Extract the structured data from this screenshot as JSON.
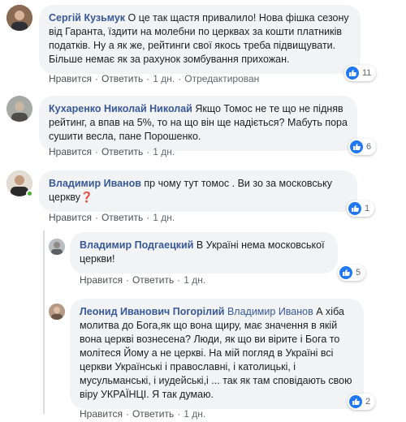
{
  "colors": {
    "author": "#385898",
    "bubble_bg": "#f2f3f5",
    "like_blue": "#2078f4",
    "online": "#42b72a"
  },
  "actions": {
    "like": "Нравится",
    "reply": "Ответить",
    "sep": "·"
  },
  "comments": [
    {
      "author": "Сергій Кузьмук",
      "text": "О це так щастя привалило! Нова фішка сезону від Гаранта, їздити на молебни по церквах за кошти платників податків. Ну а як же, рейтинги свої якось треба підвищувати. Більше немає як за рахунок зомбування прихожан.",
      "time": "1 дн.",
      "edited": "Отредактирован",
      "reactions": "11",
      "avatar_icon": "user-photo-icon"
    },
    {
      "author": "Кухаренко Николай Николай",
      "text": "Якщо Томос не те що не підняв рейтинг, а впав на 5%, то на що він ще надіється? Мабуть пора сушити весла, пане Порошенко.",
      "time": "1 дн.",
      "reactions": "6",
      "avatar_icon": "user-photo-icon"
    },
    {
      "author": "Владимир Иванов",
      "text": "пр чому тут томос . Ви зо за московську церкву",
      "emoji": "❓",
      "time": "1 дн.",
      "reactions": "1",
      "avatar_icon": "user-photo-icon"
    },
    {
      "author": "Владимир Подгаецкий",
      "text": "В Україні нема московської церкви!",
      "time": "1 дн.",
      "reactions": "5",
      "avatar_icon": "user-photo-icon"
    },
    {
      "author": "Леонид Иванович Погорілий",
      "mention": "Владимир Иванов",
      "text": "А хіба молитва до Бога,як що вона щиру, має значення в якій вона церкві вознесена? Люди, як що ви вірите і Бога то молітеся Йому а не церкві. На мій погляд в Україні всі церкви Українські і православні, і католицькі, і мусульманські, і иудейські,і ... так як там сповідають свою віру УКРАЇНЦІ. Я так думаю.",
      "time": "1 дн.",
      "reactions": "2",
      "avatar_icon": "user-photo-icon"
    }
  ]
}
